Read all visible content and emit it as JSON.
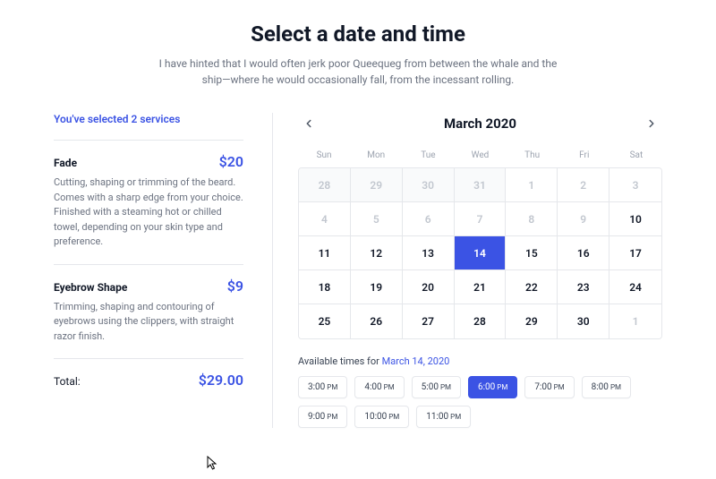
{
  "header": {
    "title": "Select a date and time",
    "subtitle": "I have hinted that I would often jerk poor Queequeg from between the whale and the ship—where he would occasionally fall, from the incessant rolling."
  },
  "sidebar": {
    "heading": "You've selected 2 services",
    "services": [
      {
        "name": "Fade",
        "price": "$20",
        "desc": "Cutting, shaping or trimming of the beard. Comes with a sharp edge from your choice. Finished with a steaming hot or chilled towel, depending on your skin type and preference."
      },
      {
        "name": "Eyebrow Shape",
        "price": "$9",
        "desc": "Trimming, shaping and contouring of eyebrows using the clippers, with straight razor finish."
      }
    ],
    "total_label": "Total:",
    "total_value": "$29.00"
  },
  "calendar": {
    "month_label": "March 2020",
    "dow": [
      "Sun",
      "Mon",
      "Tue",
      "Wed",
      "Thu",
      "Fri",
      "Sat"
    ],
    "cells": [
      {
        "n": "28",
        "cls": "other"
      },
      {
        "n": "29",
        "cls": "other"
      },
      {
        "n": "30",
        "cls": "other"
      },
      {
        "n": "31",
        "cls": "other"
      },
      {
        "n": "1",
        "cls": "dim"
      },
      {
        "n": "2",
        "cls": "dim"
      },
      {
        "n": "3",
        "cls": "dim"
      },
      {
        "n": "4",
        "cls": "dim"
      },
      {
        "n": "5",
        "cls": "dim"
      },
      {
        "n": "6",
        "cls": "dim"
      },
      {
        "n": "7",
        "cls": "dim"
      },
      {
        "n": "8",
        "cls": "dim"
      },
      {
        "n": "9",
        "cls": "dim"
      },
      {
        "n": "10",
        "cls": ""
      },
      {
        "n": "11",
        "cls": ""
      },
      {
        "n": "12",
        "cls": ""
      },
      {
        "n": "13",
        "cls": ""
      },
      {
        "n": "14",
        "cls": "sel"
      },
      {
        "n": "15",
        "cls": ""
      },
      {
        "n": "16",
        "cls": ""
      },
      {
        "n": "17",
        "cls": ""
      },
      {
        "n": "18",
        "cls": ""
      },
      {
        "n": "19",
        "cls": ""
      },
      {
        "n": "20",
        "cls": ""
      },
      {
        "n": "21",
        "cls": ""
      },
      {
        "n": "22",
        "cls": ""
      },
      {
        "n": "23",
        "cls": ""
      },
      {
        "n": "24",
        "cls": ""
      },
      {
        "n": "25",
        "cls": ""
      },
      {
        "n": "26",
        "cls": ""
      },
      {
        "n": "27",
        "cls": ""
      },
      {
        "n": "28",
        "cls": ""
      },
      {
        "n": "29",
        "cls": ""
      },
      {
        "n": "30",
        "cls": ""
      },
      {
        "n": "1",
        "cls": "dim"
      }
    ]
  },
  "availability": {
    "label_prefix": "Available times for ",
    "date_text": "March 14, 2020",
    "times": [
      {
        "t": "3:00",
        "p": "PM",
        "sel": false
      },
      {
        "t": "4:00",
        "p": "PM",
        "sel": false
      },
      {
        "t": "5:00",
        "p": "PM",
        "sel": false
      },
      {
        "t": "6:00",
        "p": "PM",
        "sel": true
      },
      {
        "t": "7:00",
        "p": "PM",
        "sel": false
      },
      {
        "t": "8:00",
        "p": "PM",
        "sel": false
      },
      {
        "t": "9:00",
        "p": "PM",
        "sel": false
      },
      {
        "t": "10:00",
        "p": "PM",
        "sel": false
      },
      {
        "t": "11:00",
        "p": "PM",
        "sel": false
      }
    ]
  },
  "colors": {
    "accent": "#3B53E4"
  }
}
